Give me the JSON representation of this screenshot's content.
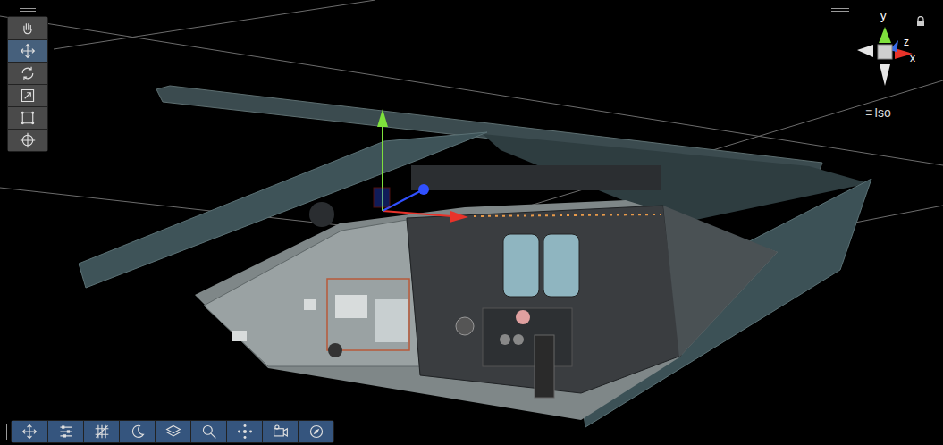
{
  "scene_view": {
    "tools": [
      {
        "kind": "hand",
        "selected": false
      },
      {
        "kind": "move",
        "selected": true
      },
      {
        "kind": "rotate",
        "selected": false
      },
      {
        "kind": "scale",
        "selected": false
      },
      {
        "kind": "rect",
        "selected": false
      },
      {
        "kind": "transform",
        "selected": false
      }
    ],
    "gizmo": {
      "axes": [
        {
          "label": "y"
        },
        {
          "label": "z"
        },
        {
          "label": "x"
        }
      ]
    },
    "projection": {
      "menu_glyph": "≡",
      "label": "Iso"
    },
    "overlay_toolbar": [
      {
        "kind": "move",
        "selected": false
      },
      {
        "kind": "sliders",
        "selected": false
      },
      {
        "kind": "grid",
        "selected": false
      },
      {
        "kind": "moon",
        "selected": false
      },
      {
        "kind": "layers",
        "selected": false
      },
      {
        "kind": "search",
        "selected": false
      },
      {
        "kind": "nodes",
        "selected": false
      },
      {
        "kind": "camera",
        "selected": false
      },
      {
        "kind": "compass",
        "selected": false
      }
    ]
  }
}
